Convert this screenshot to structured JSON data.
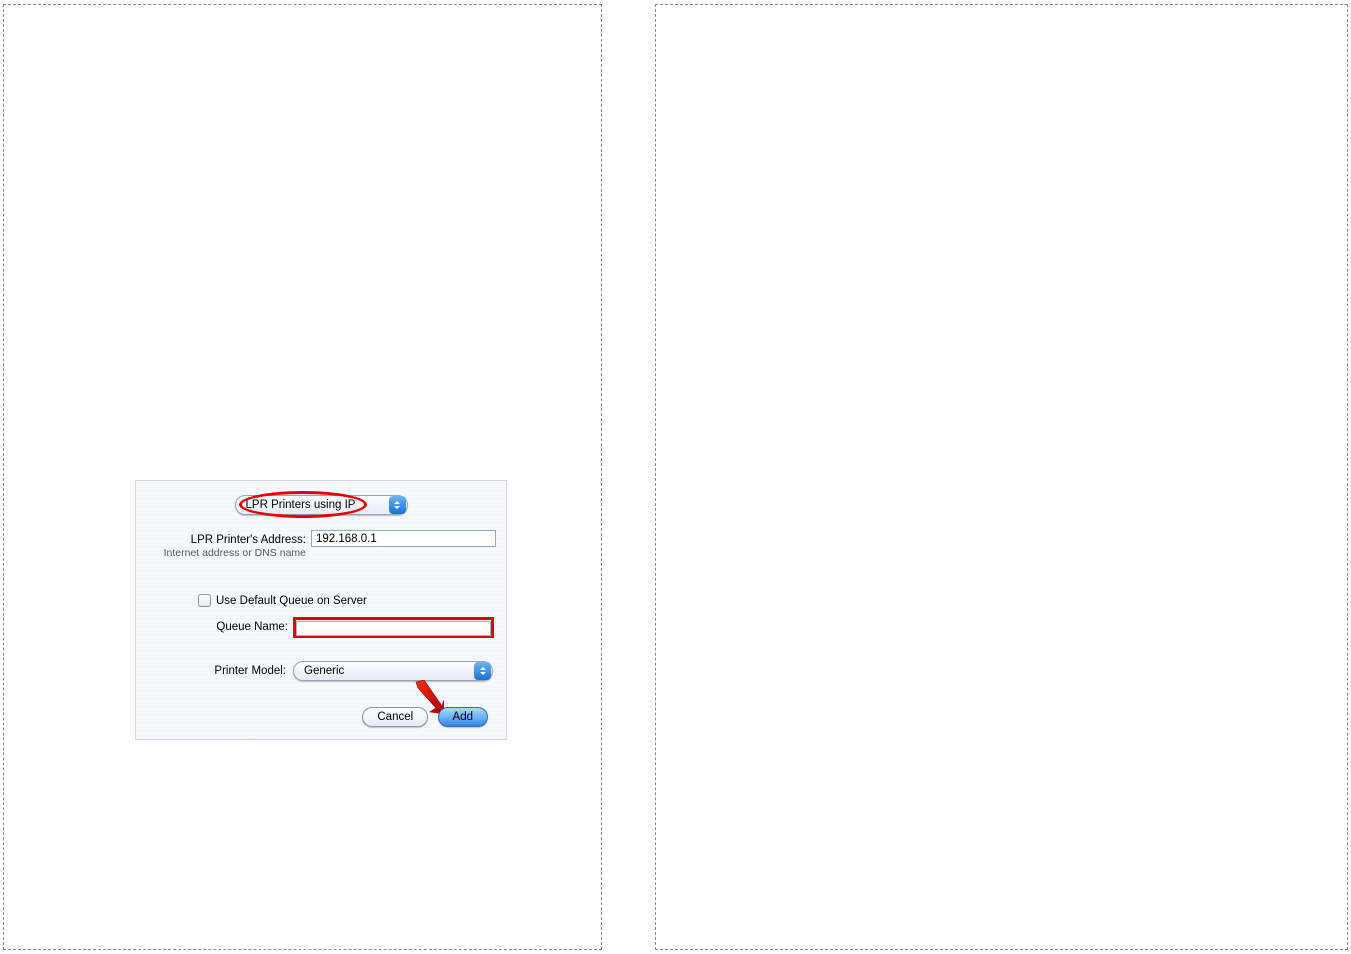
{
  "dialog": {
    "top_select": {
      "value": "LPR Printers using IP"
    },
    "address": {
      "label": "LPR Printer's Address:",
      "hint": "Internet address or DNS name",
      "value": "192.168.0.1"
    },
    "queue": {
      "checkbox_label": "Use Default Queue on Server",
      "checked": false,
      "name_label": "Queue Name:",
      "name_value": ""
    },
    "model": {
      "label": "Printer Model:",
      "value": "Generic"
    },
    "buttons": {
      "cancel": "Cancel",
      "add": "Add"
    }
  },
  "annotations": {
    "circle_around_top_select": true,
    "rectangle_around_queue_name": true,
    "arrow_pointing_to_add": true
  }
}
